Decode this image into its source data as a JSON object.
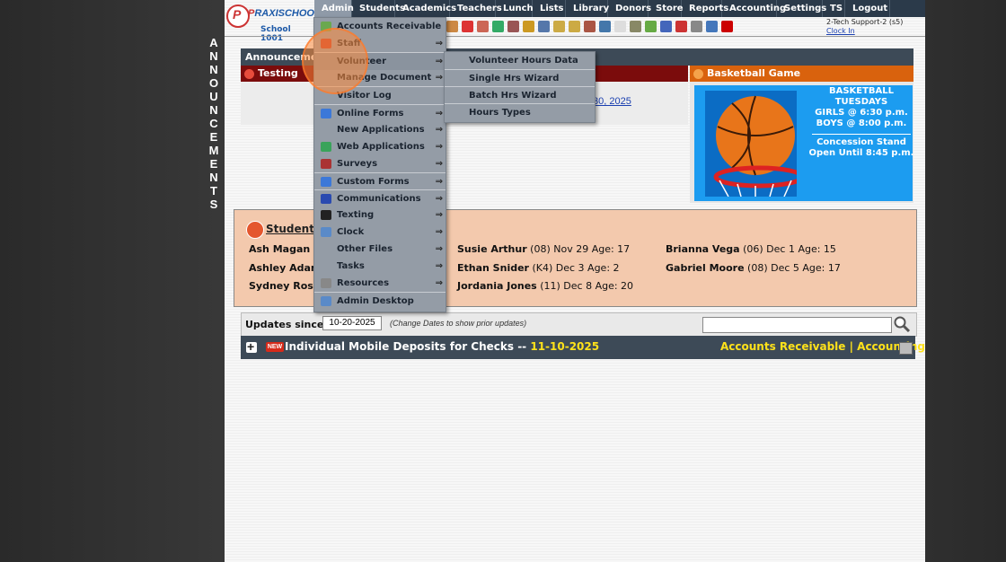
{
  "vertical_label": [
    "A",
    "N",
    "N",
    "O",
    "U",
    "N",
    "C",
    "E",
    "M",
    "E",
    "N",
    "T",
    "S"
  ],
  "logo": {
    "brand_p": "P",
    "brand_rest": "RAXISCHOOL",
    "school": "School 1001"
  },
  "nav": [
    "Admin",
    "Students",
    "Academics",
    "Teachers",
    "Lunch",
    "Lists",
    "Library",
    "Donors",
    "Store",
    "Reports",
    "Accounting",
    "Settings",
    "TS",
    "Logout"
  ],
  "user": {
    "name": "2-Tech Support-2 (s5)",
    "clock_in": "Clock In"
  },
  "announcements": {
    "header": "Announcements",
    "testing_title": "Testing",
    "testing_link": "30, 2025",
    "basketball_title": "Basketball Game",
    "basketball_lines": [
      "BASKETBALL",
      "TUESDAYS",
      "GIRLS @ 6:30 p.m.",
      "BOYS  @ 8:00 p.m."
    ],
    "basketball_lines2": [
      "Concession Stand",
      "Open Until 8:45 p.m."
    ]
  },
  "birthdays": {
    "title": "Student B",
    "entries": [
      {
        "name": "Ash Magan",
        "info": " (0"
      },
      {
        "name": "Ashley Adams",
        "info": ""
      },
      {
        "name": "Sydney Rosie",
        "info": ""
      },
      {
        "name": "Susie Arthur",
        "info": " (08) Nov 29 Age: 17"
      },
      {
        "name": "Ethan Snider",
        "info": " (K4) Dec 3 Age: 2"
      },
      {
        "name": "Jordania Jones",
        "info": " (11) Dec 8 Age: 20"
      },
      {
        "name": "Brianna Vega",
        "info": " (06) Dec 1 Age: 15"
      },
      {
        "name": "Gabriel Moore",
        "info": " (08) Dec 5 Age: 17"
      }
    ]
  },
  "updates": {
    "label": "Updates since:",
    "date": "10-20-2025",
    "hint": "(Change Dates to show prior updates)",
    "search_placeholder": "",
    "new_badge": "NEW",
    "deposit_title": "Individual Mobile Deposits for Checks -- ",
    "deposit_date": "11-10-2025",
    "links": [
      "Accounts Receivable",
      "Accounting"
    ],
    "link_sep": " | "
  },
  "menu": {
    "items": [
      {
        "label": "Accounts Receivable",
        "arrow": "",
        "icon": "money-icon",
        "color": "#6aa84f"
      },
      {
        "label": "Staff",
        "arrow": "⇒",
        "icon": "staff-icon",
        "color": "#c0392b"
      },
      {
        "label": "Volunteer",
        "arrow": "⇒",
        "icon": "",
        "color": ""
      },
      {
        "label": "Manage Document",
        "arrow": "⇒",
        "icon": "",
        "color": ""
      },
      {
        "label": "Visitor Log",
        "arrow": "",
        "icon": "",
        "color": ""
      },
      {
        "label": "Online Forms",
        "arrow": "⇒",
        "icon": "form-icon",
        "color": "#3c78d8"
      },
      {
        "label": "New Applications",
        "arrow": "⇒",
        "icon": "",
        "color": ""
      },
      {
        "label": "Web Applications",
        "arrow": "⇒",
        "icon": "globe-icon",
        "color": "#3aa35a"
      },
      {
        "label": "Surveys",
        "arrow": "⇒",
        "icon": "survey-icon",
        "color": "#a33"
      },
      {
        "label": "Custom Forms",
        "arrow": "⇒",
        "icon": "form-icon",
        "color": "#3c78d8"
      },
      {
        "label": "Communications",
        "arrow": "⇒",
        "icon": "at-icon",
        "color": "#2a4ab0"
      },
      {
        "label": "Texting",
        "arrow": "⇒",
        "icon": "phone-icon",
        "color": "#222"
      },
      {
        "label": "Clock",
        "arrow": "⇒",
        "icon": "clock-icon",
        "color": "#5a8ac8"
      },
      {
        "label": "Other Files",
        "arrow": "⇒",
        "icon": "",
        "color": ""
      },
      {
        "label": "Tasks",
        "arrow": "⇒",
        "icon": "",
        "color": ""
      },
      {
        "label": "Resources",
        "arrow": "⇒",
        "icon": "resources-icon",
        "color": "#888"
      },
      {
        "label": "Admin Desktop",
        "arrow": "",
        "icon": "desktop-icon",
        "color": "#5a8ac8"
      }
    ],
    "submenu": [
      "Volunteer Hours Data",
      "Single Hrs Wizard",
      "Batch Hrs Wizard",
      "Hours Types"
    ]
  },
  "colors": {
    "nav_bg": "#2b3a4a",
    "accent_yellow": "#ffe21a",
    "testing_red": "#7b0c0c",
    "bb_orange": "#d9620d"
  }
}
